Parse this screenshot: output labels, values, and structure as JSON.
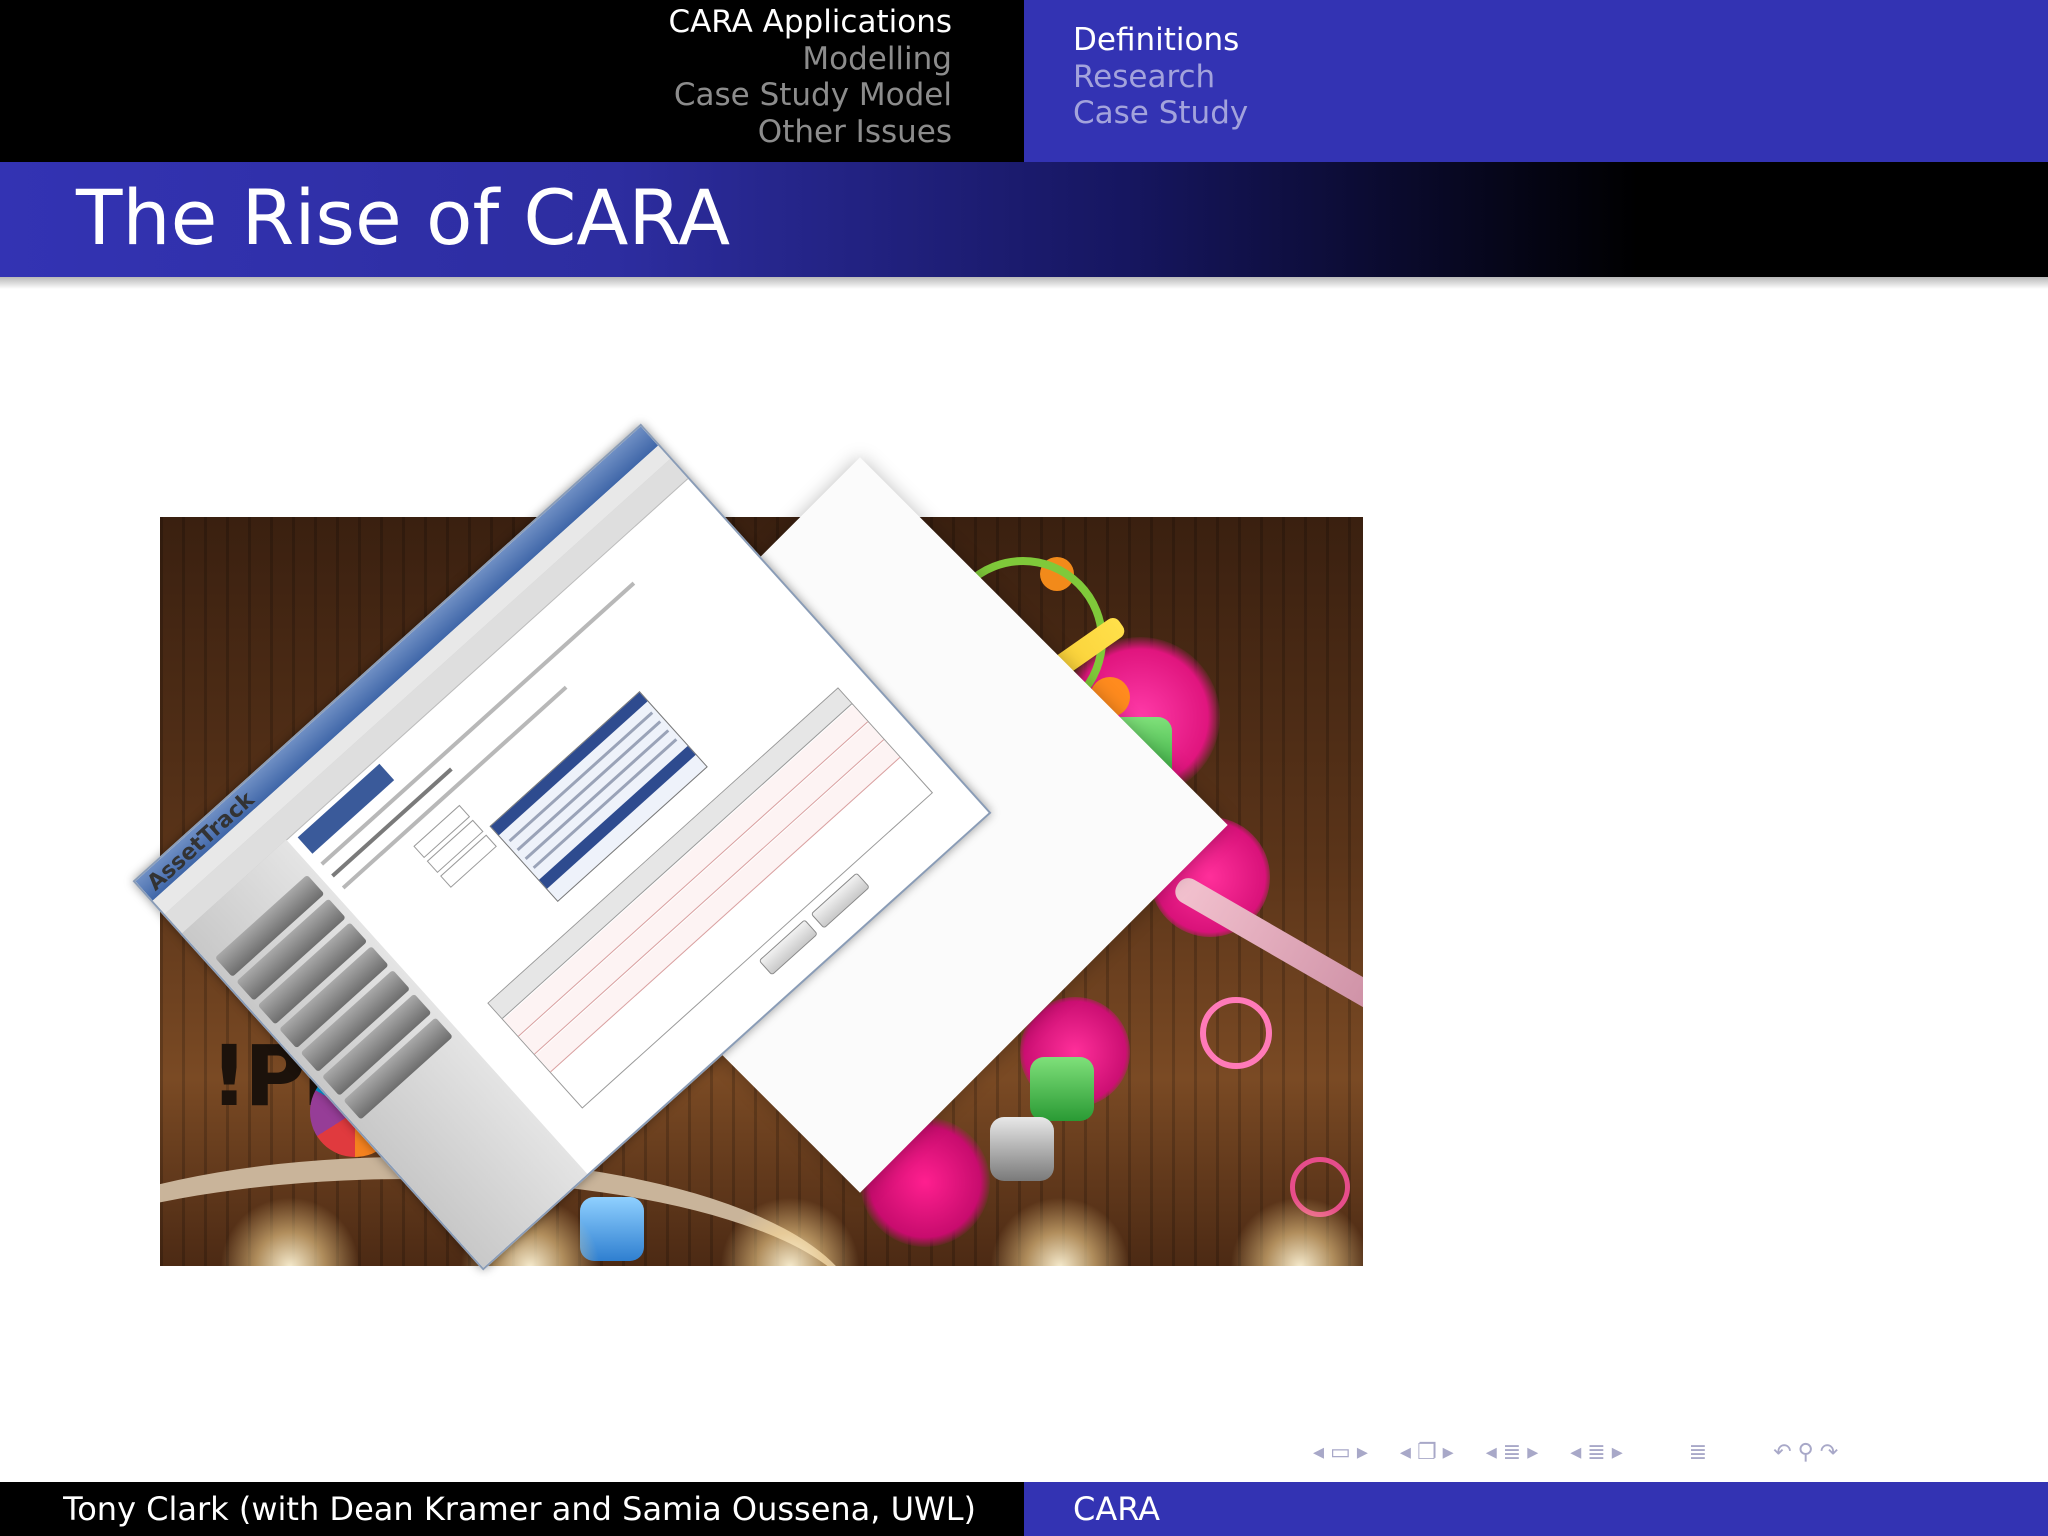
{
  "header": {
    "sections": [
      "CARA Applications",
      "Modelling",
      "Case Study Model",
      "Other Issues"
    ],
    "active_section": "CARA Applications",
    "subsections": [
      "Definitions",
      "Research",
      "Case Study"
    ],
    "active_subsection": "Definitions"
  },
  "slide": {
    "title": "The Rise of CARA"
  },
  "image": {
    "logo_text": "!PH",
    "window_logo": "AssetTrack"
  },
  "navigation": {
    "icons": [
      "nav-prev-frame-icon",
      "nav-frame-icon",
      "nav-next-frame-icon",
      "nav-prev-slide-icon",
      "nav-slide-icon",
      "nav-next-slide-icon",
      "nav-prev-subsection-icon",
      "nav-subsection-icon",
      "nav-next-subsection-icon",
      "nav-prev-section-icon",
      "nav-section-icon",
      "nav-next-section-icon",
      "nav-appendix-icon",
      "nav-back-icon",
      "nav-search-icon",
      "nav-forward-icon"
    ]
  },
  "footer": {
    "author": "Tony Clark (with Dean Kramer and Samia Oussena, UWL)",
    "short_title": "CARA"
  },
  "colors": {
    "accent_blue": "#3333b3",
    "black": "#000000",
    "inactive_gray": "#8c8c8c",
    "inactive_blue": "#a3a3dc"
  }
}
